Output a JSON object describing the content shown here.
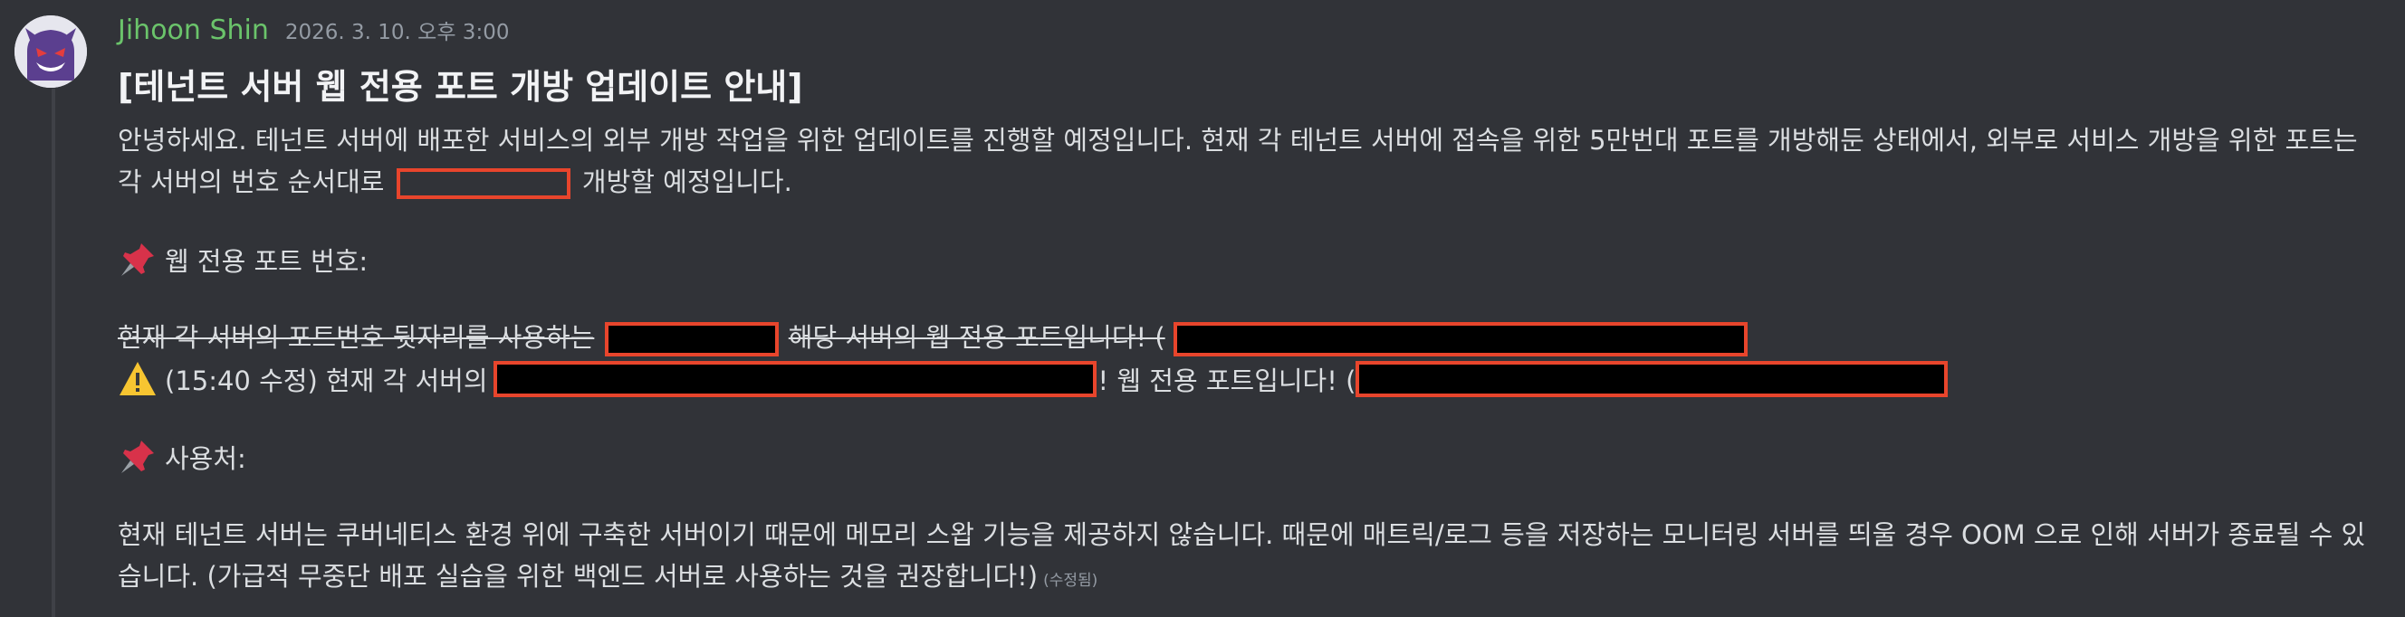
{
  "message": {
    "username": "Jihoon Shin",
    "timestamp": "2026. 3. 10. 오후 3:00",
    "title": "[테넌트 서버 웹 전용 포트 개방 업데이트 안내]",
    "intro_line1": "안녕하세요. 테넌트 서버에 배포한 서비스의 외부 개방 작업을 위한 업데이트를 진행할 예정입니다. 현재 각 테넌트 서버에 접속을 위한 5만번대 포트를 개방해둔 상태에서, 외부로 서비스 개방을 위한 포트는",
    "intro_line2_pre": "각 서버의 번호 순서대로",
    "intro_line2_post": "개방할 예정입니다.",
    "section1_label": "웹 전용 포트 번호:",
    "strike_pre": "현재 각 서버의 포트번호 뒷자리를 사용하는",
    "strike_mid": "해당 서버의 웹 전용 포트입니다! (",
    "update_pre": "(15:40 수정) 현재 각 서버의",
    "update_mid": "! 웹 전용 포트입니다! (",
    "section2_label": "사용처:",
    "usage_line1": "현재 테넌트 서버는 쿠버네티스 환경 위에 구축한 서버이기 때문에 메모리 스왑 기능을 제공하지 않습니다. 때문에 매트릭/로그 등을 저장하는 모니터링 서버를 띄울 경우 OOM 으로 인해 서버가 종료될 수 있",
    "usage_line2": "습니다. (가급적 무중단 배포 실습을 위한 백엔드 서버로 사용하는 것을 권장합니다!)",
    "edited_label": "(수정됨)"
  },
  "icons": {
    "pin": "pushpin-icon",
    "warning": "warning-icon",
    "avatar": "ghost-avatar"
  },
  "colors": {
    "background": "#313338",
    "username": "#6bc46b",
    "redaction_border": "#e8452c",
    "text": "#dbdee1",
    "muted": "#949ba4"
  }
}
